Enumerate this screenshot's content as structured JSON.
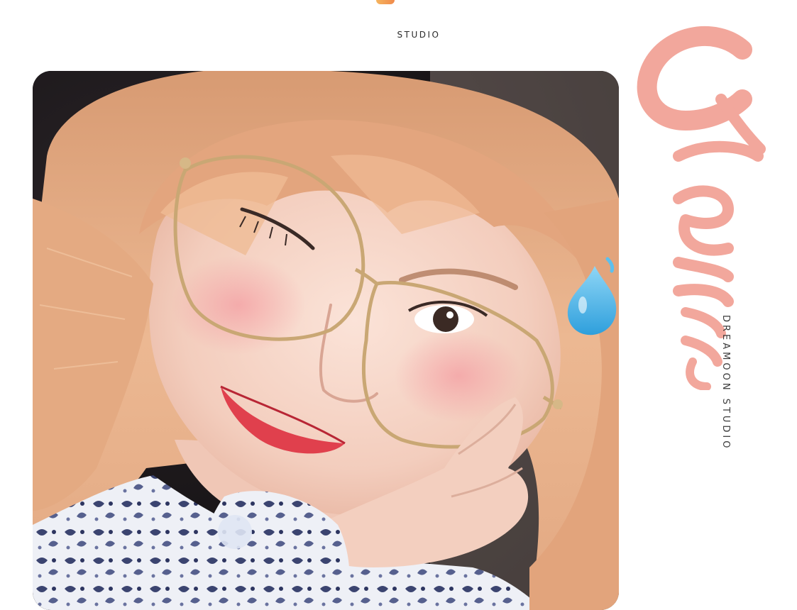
{
  "header": {
    "studio_label": "STUDIO"
  },
  "side": {
    "signature_text": "Chenn",
    "brand_vertical": "DREAMOON STUDIO"
  },
  "photo": {
    "alt": "Smiling woman with light peach-blonde bob hair, wearing thin gold square glasses, resting cheek on hand, winking, with a blue sweat-drop sticker"
  },
  "colors": {
    "background": "#ffffff",
    "signature_pink": "#f2a79c",
    "hair": "#e8b088",
    "drop_blue": "#5cc0ee",
    "text_dark": "#2a2a2a"
  }
}
